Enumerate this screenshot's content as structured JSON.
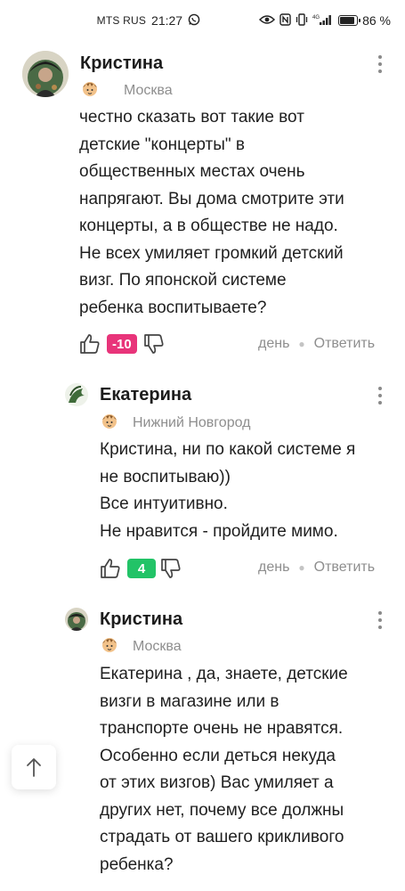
{
  "status_bar": {
    "carrier": "MTS RUS",
    "time": "21:27",
    "network": "4G",
    "battery_percent": "86 %",
    "battery_level": 0.86
  },
  "comments": [
    {
      "author": "Кристина",
      "city": "Москва",
      "text_lines": [
        "честно сказать вот такие вот",
        "детские \"концерты\" в",
        "общественных местах очень",
        "напрягают. Вы дома смотрите эти",
        "концерты, а в обществе не надо.",
        "Не всех умиляет громкий детский",
        "визг. По японской системе",
        "ребенка воспитываете?"
      ],
      "rating": "-10",
      "time": "день",
      "reply_label": "Ответить",
      "badge_color": "#e8347a"
    },
    {
      "author": "Екатерина",
      "city": "Нижний Новгород",
      "text_lines": [
        "Кристина, ни по какой системе я",
        "не воспитываю))",
        "Все интуитивно.",
        "Не нравится - пройдите мимо."
      ],
      "rating": "4",
      "time": "день",
      "reply_label": "Ответить",
      "badge_color": "#22c367"
    },
    {
      "author": "Кристина",
      "city": "Москва",
      "text_lines": [
        "Екатерина , да, знаете, детские",
        "визги в магазине или в",
        "транспорте очень не нравятся.",
        "Особенно если деться некуда",
        "от этих визгов) Вас умиляет а",
        "других нет, почему все должны",
        "страдать от вашего крикливого",
        "ребенка?"
      ]
    }
  ]
}
